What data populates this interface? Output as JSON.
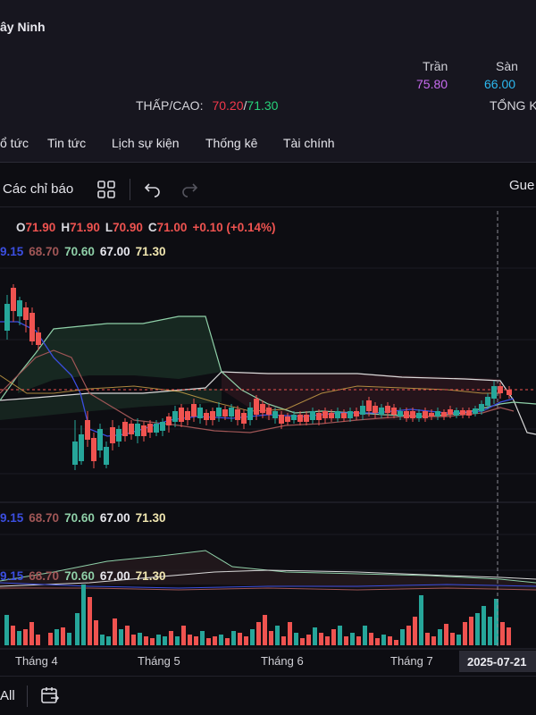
{
  "header": {
    "company": "ây Ninh",
    "ceiling_label": "Trần",
    "floor_label": "Sàn",
    "ceiling_value": "75.80",
    "floor_value": "66.00",
    "low_high_label": "THẤP/CAO:",
    "low_value": "70.20",
    "separator": "/",
    "high_value": "71.30",
    "total_label": "TỔNG K"
  },
  "tabs": [
    {
      "label": "ổ tức"
    },
    {
      "label": "Tin tức"
    },
    {
      "label": "Lịch sự kiện"
    },
    {
      "label": "Thống kê"
    },
    {
      "label": "Tài chính"
    }
  ],
  "toolbar": {
    "indicators_label": "Các chỉ báo",
    "guest_label": "Gue",
    "icons": [
      "grid-icon",
      "undo-icon",
      "redo-icon"
    ]
  },
  "ohlc": {
    "o_label": "O",
    "o": "71.90",
    "h_label": "H",
    "h": "71.90",
    "l_label": "L",
    "l": "70.90",
    "c_label": "C",
    "c": "71.00",
    "change": "+0.10 (+0.14%)"
  },
  "ichimoku": {
    "v1": "9.15",
    "v2": "68.70",
    "v3": "70.60",
    "v4": "67.00",
    "v5": "71.30"
  },
  "x_axis": {
    "labels": [
      "Tháng 4",
      "Tháng 5",
      "Tháng 6",
      "Tháng 7"
    ],
    "crosshair_date": "2025-07-21"
  },
  "bottombar": {
    "all_label": "All"
  },
  "colors": {
    "up": "#26a69a",
    "down": "#ef5350",
    "ceiling": "#c86cf0",
    "floor": "#2cb9f0",
    "low": "#f2384b",
    "high": "#27d27a",
    "tenkan": "#3b4ee0",
    "kijun": "#a05656",
    "span_a": "#8fd0a8",
    "span_b": "#d9d9d9",
    "chikou": "#d4a84a"
  }
}
